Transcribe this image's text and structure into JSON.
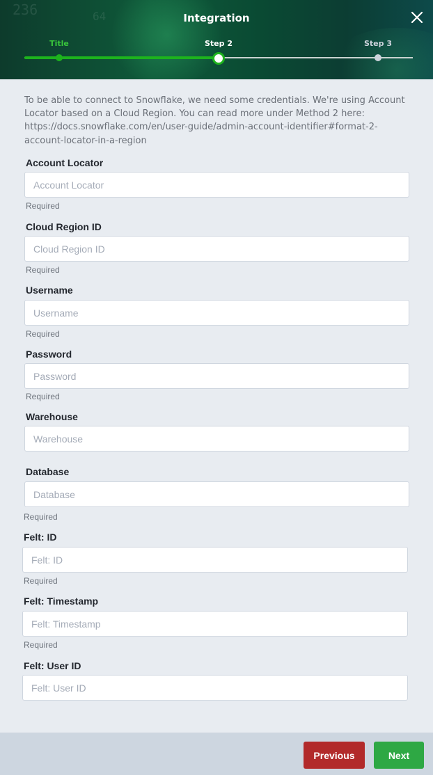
{
  "header": {
    "title": "Integration",
    "background_digits": [
      "236",
      "64"
    ],
    "steps": [
      {
        "label": "Title",
        "state": "completed",
        "color": "#39c73c"
      },
      {
        "label": "Step 2",
        "state": "current",
        "color": "#ffffff"
      },
      {
        "label": "Step 3",
        "state": "upcoming",
        "color": "#cdd3dc"
      }
    ],
    "close_icon": "close-icon"
  },
  "intro": "To be able to connect to Snowflake, we need some credentials. We're using Account Locator based on a Cloud Region. You can read more under Method 2 here: https://docs.snowflake.com/en/user-guide/admin-account-identifier#format-2-account-locator-in-a-region",
  "fields": [
    {
      "label": "Account Locator",
      "placeholder": "Account Locator",
      "value": "",
      "help": "Required"
    },
    {
      "label": "Cloud Region ID",
      "placeholder": "Cloud Region ID",
      "value": "",
      "help": "Required"
    },
    {
      "label": "Username",
      "placeholder": "Username",
      "value": "",
      "help": "Required"
    },
    {
      "label": "Password",
      "placeholder": "Password",
      "value": "",
      "help": "Required"
    },
    {
      "label": "Warehouse",
      "placeholder": "Warehouse",
      "value": "",
      "help": ""
    },
    {
      "label": "Database",
      "placeholder": "Database",
      "value": "",
      "help": "Required"
    },
    {
      "label": "Felt: ID",
      "placeholder": "Felt: ID",
      "value": "",
      "help": "Required"
    },
    {
      "label": "Felt: Timestamp",
      "placeholder": "Felt: Timestamp",
      "value": "",
      "help": "Required"
    },
    {
      "label": "Felt: User ID",
      "placeholder": "Felt: User ID",
      "value": "",
      "help": ""
    }
  ],
  "footer": {
    "previous_label": "Previous",
    "next_label": "Next",
    "previous_color": "#b22a2a",
    "next_color": "#2ea844"
  },
  "colors": {
    "accent_green": "#1db31d",
    "page_background": "#e8ecf1"
  }
}
